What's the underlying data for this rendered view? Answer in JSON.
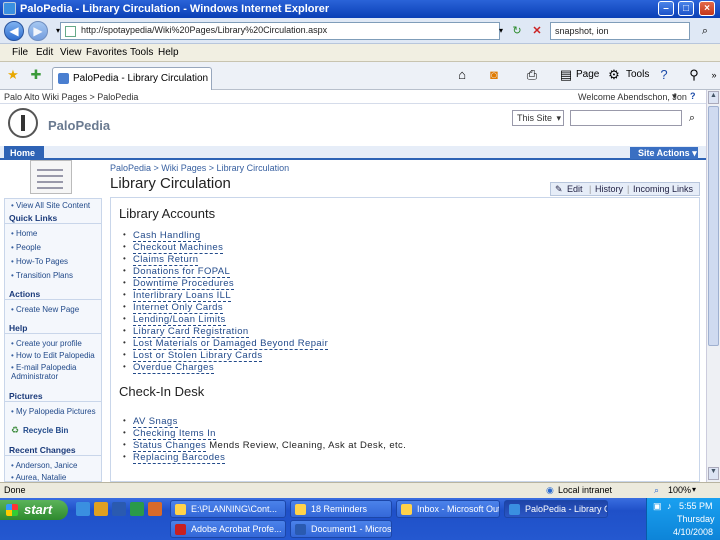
{
  "window": {
    "title": "PaloPedia - Library Circulation - Windows Internet Explorer",
    "minimize": "–",
    "maximize": "□",
    "close": "×"
  },
  "addressbar": {
    "url": "http://spotaypedia/Wiki%20Pages/Library%20Circulation.aspx",
    "search_value": "snapshot, ion"
  },
  "menubar": [
    "File",
    "Edit",
    "View",
    "Favorites",
    "Tools",
    "Help"
  ],
  "tab": {
    "label": "PaloPedia - Library Circulation"
  },
  "commandbar": {
    "page": "Page",
    "tools": "Tools"
  },
  "site": {
    "breadcrumb_top": "Palo Alto Wiki Pages > PaloPedia",
    "welcome": "Welcome Abendschon, Jon",
    "name": "PaloPedia",
    "search_scope": "This Site",
    "home_tab": "Home",
    "site_actions": "Site Actions"
  },
  "page": {
    "breadcrumb": "PaloPedia > Wiki Pages > Library Circulation",
    "title": "Library Circulation",
    "actions": {
      "edit": "Edit",
      "history": "History",
      "incoming": "Incoming Links"
    }
  },
  "leftnav": {
    "view_all": "View All Site Content",
    "quick_links_head": "Quick Links",
    "quick_links": [
      "Home",
      "People",
      "How-To Pages",
      "Transition Plans"
    ],
    "actions_head": "Actions",
    "actions": [
      "Create New Page"
    ],
    "help_head": "Help",
    "help": [
      "Create your profile",
      "How to Edit Palopedia",
      "E-mail Palopedia Administrator"
    ],
    "pictures_head": "Pictures",
    "pictures": [
      "My Palopedia Pictures"
    ],
    "recycle_bin": "Recycle Bin",
    "recent_head": "Recent Changes",
    "recent": [
      "Anderson, Janice",
      "Aurea, Natalie"
    ]
  },
  "content": {
    "section1": "Library Accounts",
    "accounts": [
      "Cash Handling",
      "Checkout Machines",
      "Claims Return",
      "Donations for FOPAL",
      "Downtime Procedures",
      "Interlibrary Loans ILL",
      "Internet Only Cards",
      "Lending/Loan Limits",
      "Library Card Registration",
      "Lost Materials or Damaged Beyond Repair",
      "Lost or Stolen Library Cards",
      "Overdue Charges"
    ],
    "section2": "Check-In Desk",
    "checkin": [
      {
        "link": "AV Snags",
        "extra": ""
      },
      {
        "link": "Checking Items In",
        "extra": ""
      },
      {
        "link": "Status Changes",
        "extra": " Mends Review, Cleaning, Ask at Desk, etc."
      },
      {
        "link": "Replacing Barcodes",
        "extra": ""
      }
    ]
  },
  "statusbar": {
    "left": "Done",
    "zone": "Local intranet",
    "zoom": "100%"
  },
  "taskbar": {
    "start": "start",
    "buttons": [
      "E:\\PLANNING\\Cont...",
      "18 Reminders",
      "Inbox - Microsoft Out...",
      "PaloPedia - Library C...",
      "Adobe Acrobat Profe...",
      "Document1 - Microso..."
    ],
    "time": "5:55 PM",
    "day": "Thursday",
    "date": "4/10/2008"
  }
}
